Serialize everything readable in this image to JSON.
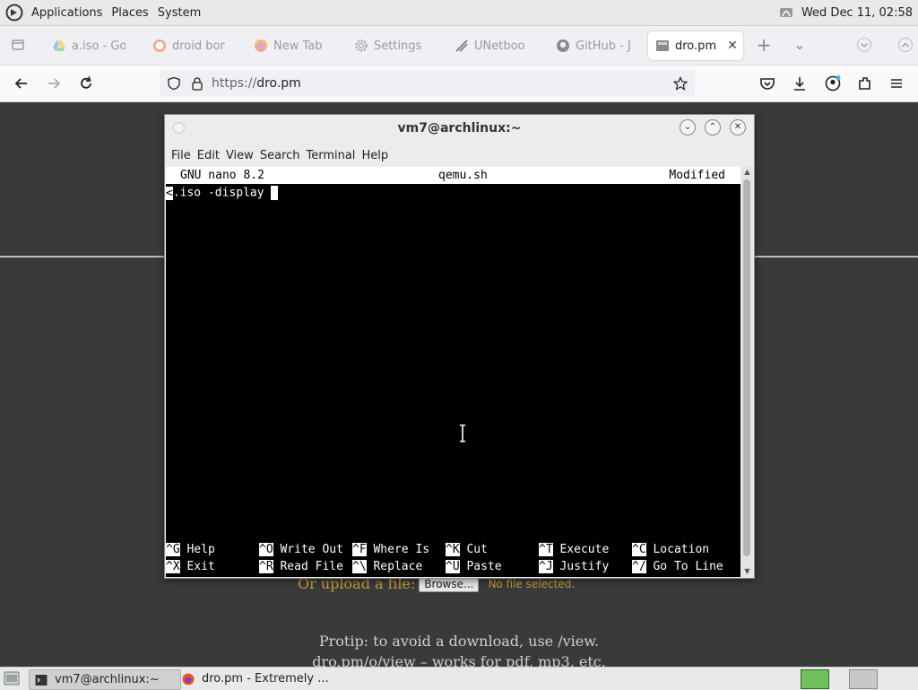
{
  "top_panel": {
    "menus": [
      "Applications",
      "Places",
      "System"
    ],
    "clock": "Wed Dec 11, 02:58"
  },
  "browser": {
    "tabs": [
      {
        "label": "a.iso - Go",
        "icon": "google-drive-icon"
      },
      {
        "label": "droid bor",
        "icon": "duckduckgo-icon"
      },
      {
        "label": "New Tab",
        "icon": "firefox-icon"
      },
      {
        "label": "Settings",
        "icon": "gear-icon"
      },
      {
        "label": "UNetboo",
        "icon": "unetbootin-icon"
      },
      {
        "label": "GitHub - J",
        "icon": "github-icon"
      },
      {
        "label": "dro.pm",
        "icon": "site-icon",
        "active": true
      }
    ],
    "url_prefix": "https://",
    "url_host": "dro.pm"
  },
  "page": {
    "upload_label": "Or upload a file:",
    "browse_label": "Browse...",
    "no_file": "No file selected.",
    "protip_line1": "Protip: to avoid a download, use /view.",
    "protip_line2": "dro.pm/o/view – works for pdf, mp3, etc."
  },
  "terminal": {
    "title": "vm7@archlinux:~",
    "menus": [
      "File",
      "Edit",
      "View",
      "Search",
      "Terminal",
      "Help"
    ],
    "nano": {
      "version": "GNU nano 8.2",
      "filename": "qemu.sh",
      "status": "Modified",
      "line_marker": "<",
      "line_text": ".iso -display ",
      "shortcuts_row1": [
        {
          "key": "^G",
          "label": "Help"
        },
        {
          "key": "^O",
          "label": "Write Out"
        },
        {
          "key": "^F",
          "label": "Where Is"
        },
        {
          "key": "^K",
          "label": "Cut"
        },
        {
          "key": "^T",
          "label": "Execute"
        },
        {
          "key": "^C",
          "label": "Location"
        }
      ],
      "shortcuts_row2": [
        {
          "key": "^X",
          "label": "Exit"
        },
        {
          "key": "^R",
          "label": "Read File"
        },
        {
          "key": "^\\",
          "label": "Replace"
        },
        {
          "key": "^U",
          "label": "Paste"
        },
        {
          "key": "^J",
          "label": "Justify"
        },
        {
          "key": "^/",
          "label": "Go To Line"
        }
      ]
    }
  },
  "taskbar": {
    "tasks": [
      {
        "label": "vm7@archlinux:~",
        "icon": "terminal-icon",
        "active": true
      },
      {
        "label": "dro.pm - Extremely ...",
        "icon": "firefox-icon",
        "active": false
      }
    ]
  }
}
